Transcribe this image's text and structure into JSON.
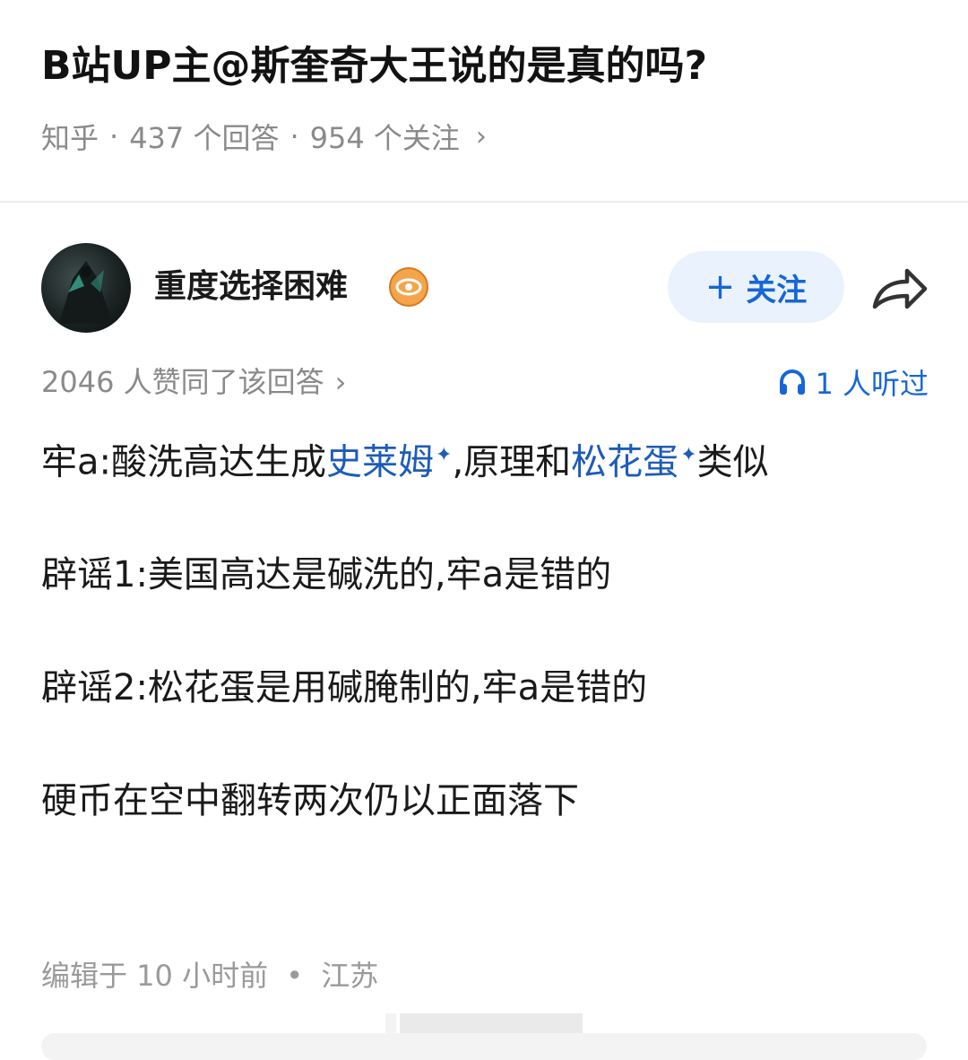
{
  "question": {
    "title": "B站UP主@斯奎奇大王说的是真的吗?",
    "source": "知乎",
    "answers": "437 个回答",
    "followers": "954 个关注",
    "separator": "·"
  },
  "author": {
    "name": "重度选择困难",
    "follow_plus": "+",
    "follow_label": "关注"
  },
  "stats": {
    "likes_text": "2046 人赞同了该回答",
    "listened_text": "1 人听过"
  },
  "content": {
    "p1": {
      "seg1": "牢a:酸洗高达生成",
      "link1": "史莱姆",
      "seg2": ",原理和",
      "link2": "松花蛋",
      "seg3": "类似",
      "spark": "✦"
    },
    "p2": "辟谣1:美国高达是碱洗的,牢a是错的",
    "p3": "辟谣2:松花蛋是用碱腌制的,牢a是错的",
    "p4": "硬币在空中翻转两次仍以正面落下"
  },
  "footer": {
    "edited": "编辑于 10 小时前",
    "dot": "•",
    "location": "江苏"
  },
  "icons": {
    "chevron": "›",
    "share": "share-arrow-icon",
    "headphone": "headphone-icon",
    "badge": "eye-badge-icon"
  },
  "colors": {
    "accent": "#1766d6",
    "link": "#1d5cb8",
    "badge": "#f4a54b",
    "meta": "#8a8a8a"
  }
}
